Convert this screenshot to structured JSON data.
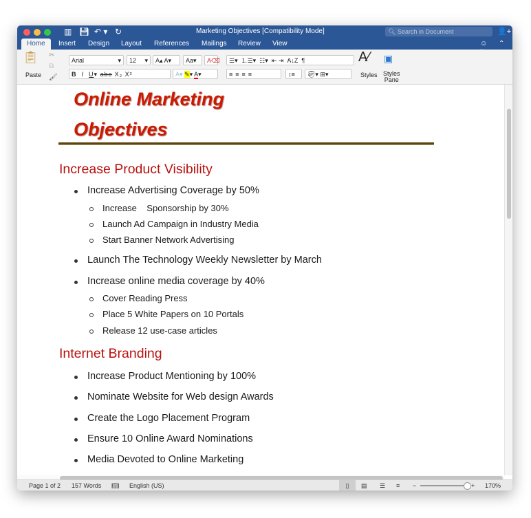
{
  "window": {
    "title": "Marketing Objectives [Compatibility Mode]",
    "search_placeholder": "Search in Document"
  },
  "tabs": [
    "Home",
    "Insert",
    "Design",
    "Layout",
    "References",
    "Mailings",
    "Review",
    "View"
  ],
  "ribbon": {
    "paste": "Paste",
    "font": "Arial",
    "size": "12",
    "styles": "Styles",
    "styles_pane_1": "Styles",
    "styles_pane_2": "Pane",
    "bold": "B",
    "italic": "I",
    "underline": "U",
    "strike": "abc",
    "sub": "X₂",
    "sup": "X²",
    "pilcrow": "¶"
  },
  "document": {
    "title_line1": "Online Marketing",
    "title_line2": "Objectives",
    "items": [
      {
        "type": "section",
        "text": "Increase Product Visibility"
      },
      {
        "type": "l1",
        "text": "Increase Advertising Coverage by 50%"
      },
      {
        "type": "l2",
        "text": "Increase    Sponsorship by 30%"
      },
      {
        "type": "l2",
        "text": "Launch Ad Campaign in Industry Media"
      },
      {
        "type": "l2",
        "text": "Start Banner Network Advertising"
      },
      {
        "type": "l1",
        "text": "Launch The Technology Weekly Newsletter by March"
      },
      {
        "type": "l1",
        "text": "Increase online media coverage by 40%"
      },
      {
        "type": "l2",
        "text": "Cover Reading Press"
      },
      {
        "type": "l2",
        "text": "Place 5 White Papers on 10 Portals"
      },
      {
        "type": "l2",
        "text": "Release 12 use-case articles"
      },
      {
        "type": "section",
        "text": "Internet Branding"
      },
      {
        "type": "l1",
        "text": "Increase Product Mentioning by 100%"
      },
      {
        "type": "l1",
        "text": "Nominate Website for Web design Awards"
      },
      {
        "type": "l1",
        "text": "Create the Logo Placement Program"
      },
      {
        "type": "l1",
        "text": "Ensure 10 Online Award Nominations"
      },
      {
        "type": "l1",
        "text": "Media Devoted to Online Marketing"
      }
    ]
  },
  "status": {
    "page": "Page 1 of 2",
    "words": "157 Words",
    "language": "English (US)",
    "zoom": "170%",
    "zoom_level_percent": 170
  },
  "colors": {
    "titlebar": "#2b5797",
    "heading": "#cc1a00",
    "section": "#b8120f"
  }
}
